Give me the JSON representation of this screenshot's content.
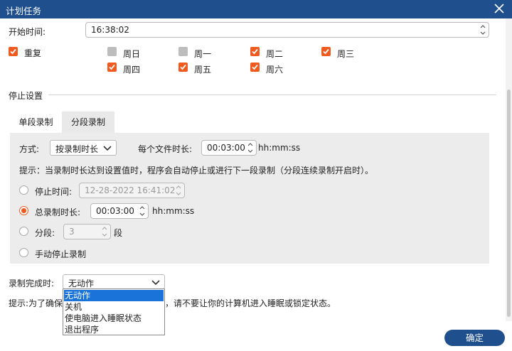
{
  "window": {
    "title": "计划任务"
  },
  "start_time": {
    "label": "开始时间:",
    "value": "16:38:02"
  },
  "repeat": {
    "label": "重复",
    "checked": true,
    "days": [
      {
        "label": "周日",
        "checked": false
      },
      {
        "label": "周一",
        "checked": false
      },
      {
        "label": "周二",
        "checked": true
      },
      {
        "label": "周三",
        "checked": true
      },
      {
        "label": "周四",
        "checked": true
      },
      {
        "label": "周五",
        "checked": true
      },
      {
        "label": "周六",
        "checked": true
      }
    ]
  },
  "stop": {
    "section_title": "停止设置",
    "tabs": [
      {
        "label": "单段录制",
        "active": false
      },
      {
        "label": "分段录制",
        "active": true
      }
    ],
    "mode": {
      "label": "方式:",
      "value": "按录制时长"
    },
    "per_file": {
      "label": "每个文件时长:",
      "value": "00:03:00",
      "unit": "hh:mm:ss"
    },
    "hint": "提示：当录制时长达到设置值时，程序会自动停止或进行下一段录制（分段连续录制开启时）。",
    "options": {
      "stop_time": {
        "label": "停止时间:",
        "value": "12-28-2022 16:41:02",
        "selected": false
      },
      "total_duration": {
        "label": "总录制时长:",
        "value": "00:03:00",
        "unit": "hh:mm:ss",
        "selected": true
      },
      "segments": {
        "label": "分段:",
        "value": "3",
        "unit": "段",
        "selected": false
      },
      "manual": {
        "label": "手动停止录制",
        "selected": false
      }
    }
  },
  "on_complete": {
    "label": "录制完成时:",
    "value": "无动作",
    "options": [
      "无动作",
      "关机",
      "使电脑进入睡眠状态",
      "退出程序"
    ],
    "selected_index": 0
  },
  "note": {
    "prefix": "提示:为了确保",
    "suffix": "，请不要让你的计算机进入睡眠或锁定状态。"
  },
  "confirm_button": "确定",
  "colors": {
    "titlebar": "#1f4f8c",
    "accent": "#f05a1e",
    "menu_selection": "#1a73d9"
  }
}
